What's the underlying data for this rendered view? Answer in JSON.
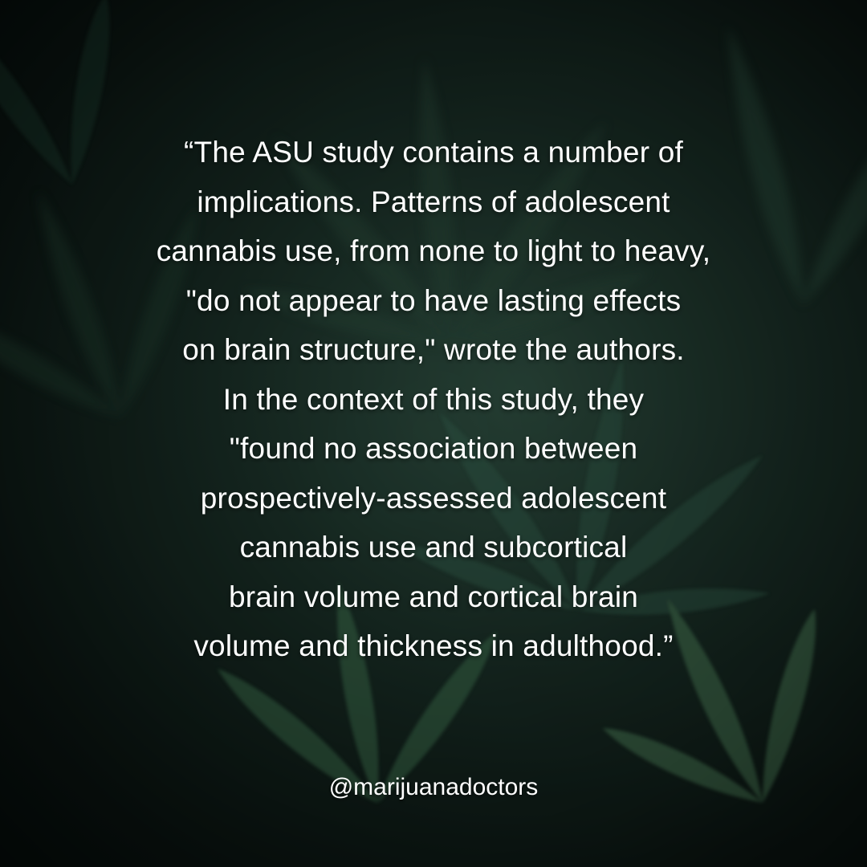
{
  "quote_lines": [
    "“The ASU study contains a number of",
    "implications. Patterns of adolescent",
    "cannabis use, from none to light to heavy,",
    "\"do not appear to have lasting effects",
    "on brain structure,\" wrote the authors.",
    "In the context of this study, they",
    "\"found no association between",
    "prospectively-assessed adolescent",
    "cannabis use and subcortical",
    "brain volume and cortical brain",
    "volume and thickness in adulthood.”"
  ],
  "handle": "@marijuanadoctors",
  "colors": {
    "text": "#ffffff",
    "leaf_dark": "#1f3a2f",
    "leaf_mid": "#2f5444",
    "leaf_light": "#4a7a57",
    "background": "#0b1512"
  }
}
